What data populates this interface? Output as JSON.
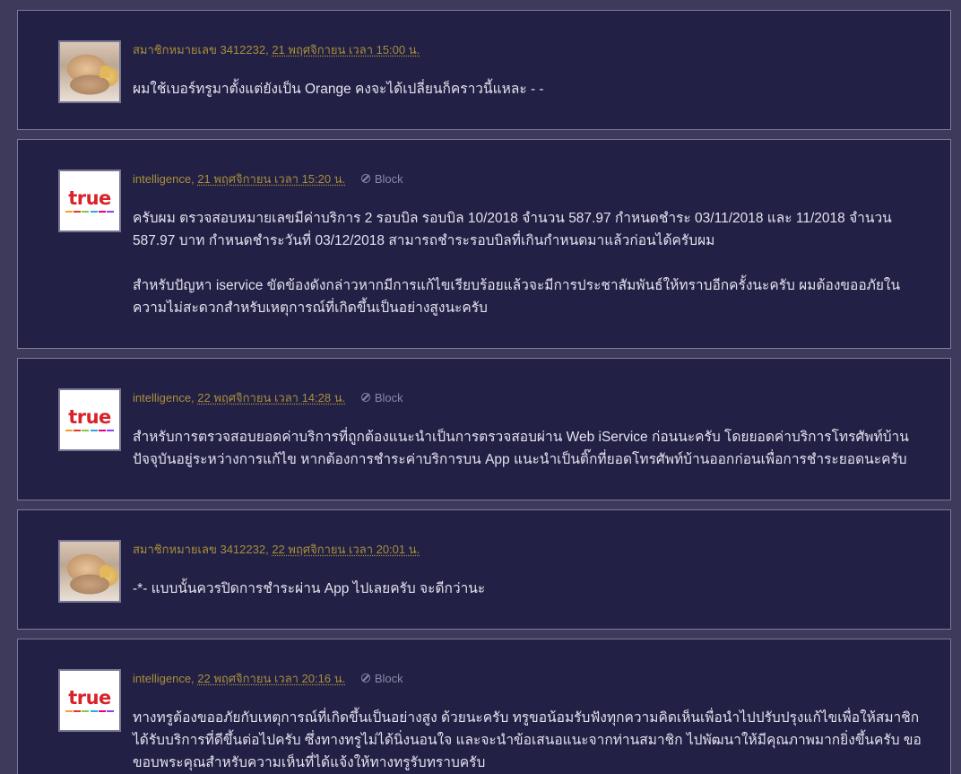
{
  "comments": [
    {
      "author": "สมาชิกหมายเลข 3412232",
      "date": "21 พฤศจิกายน เวลา 15:00 น.",
      "avatar": "cake-avatar",
      "paragraphs": [
        "ผมใช้เบอร์ทรูมาตั้งแต่ยังเป็น Orange คงจะได้เปลี่ยนก็คราวนี้แหละ - -"
      ]
    },
    {
      "author": "intelligence",
      "date": "21 พฤศจิกายน เวลา 15:20 น.",
      "block_label": "Block",
      "avatar": "true-logo",
      "paragraphs": [
        "ครับผม ตรวจสอบหมายเลขมีค่าบริการ 2 รอบบิล รอบบิล 10/2018 จำนวน 587.97 กำหนดชำระ 03/11/2018 และ 11/2018 จำนวน 587.97 บาท กำหนดชำระวันที่ 03/12/2018 สามารถชำระรอบบิลที่เกินกำหนดมาแล้วก่อนได้ครับผม",
        "สำหรับปัญหา iservice ขัดข้องดังกล่าวหากมีการแก้ไขเรียบร้อยแล้วจะมีการประชาสัมพันธ์ให้ทราบอีกครั้งนะครับ ผมต้องขออภัยในความไม่สะดวกสำหรับเหตุการณ์ที่เกิดขึ้นเป็นอย่างสูงนะครับ"
      ]
    },
    {
      "author": "intelligence",
      "date": "22 พฤศจิกายน เวลา 14:28 น.",
      "block_label": "Block",
      "avatar": "true-logo",
      "paragraphs": [
        "สำหรับการตรวจสอบยอดค่าบริการที่ถูกต้องแนะนำเป็นการตรวจสอบผ่าน Web iService ก่อนนะครับ โดยยอดค่าบริการโทรศัพท์บ้านปัจจุบันอยู่ระหว่างการแก้ไข หากต้องการชำระค่าบริการบน App แนะนำเป็นติ๊กที่ยอดโทรศัพท์บ้านออกก่อนเพื่อการชำระยอดนะครับ"
      ]
    },
    {
      "author": "สมาชิกหมายเลข 3412232",
      "date": "22 พฤศจิกายน เวลา 20:01 น.",
      "avatar": "cake-avatar",
      "paragraphs": [
        "-*- แบบนั้นควรปิดการชำระผ่าน App ไปเลยครับ จะดีกว่านะ"
      ]
    },
    {
      "author": "intelligence",
      "date": "22 พฤศจิกายน เวลา 20:16 น.",
      "block_label": "Block",
      "avatar": "true-logo",
      "paragraphs": [
        "ทางทรูต้องขออภัยกับเหตุการณ์ที่เกิดขึ้นเป็นอย่างสูง ด้วยนะครับ ทรูขอน้อมรับฟังทุกความคิดเห็นเพื่อนำไปปรับปรุงแก้ไขเพื่อให้สมาชิกได้รับบริการที่ดีขึ้นต่อไปครับ ซึ่งทางทรูไม่ได้นิ่งนอนใจ และจะนำข้อเสนอแนะจากท่านสมาชิก ไปพัฒนาให้มีคุณภาพมากยิ่งขึ้นครับ ขอขอบพระคุณสำหรับความเห็นที่ได้แจ้งให้ทางทรูรับทราบครับ"
      ]
    }
  ],
  "true_logo": {
    "word": "true",
    "colors": [
      "#f2a22c",
      "#e8342e",
      "#8cc63f",
      "#29a9e0",
      "#e6007e",
      "#8a3ffc"
    ]
  },
  "colors": {
    "background": "#3e3a5c",
    "card": "#222044",
    "author": "#a98f3c",
    "text": "#e4e2ee"
  }
}
